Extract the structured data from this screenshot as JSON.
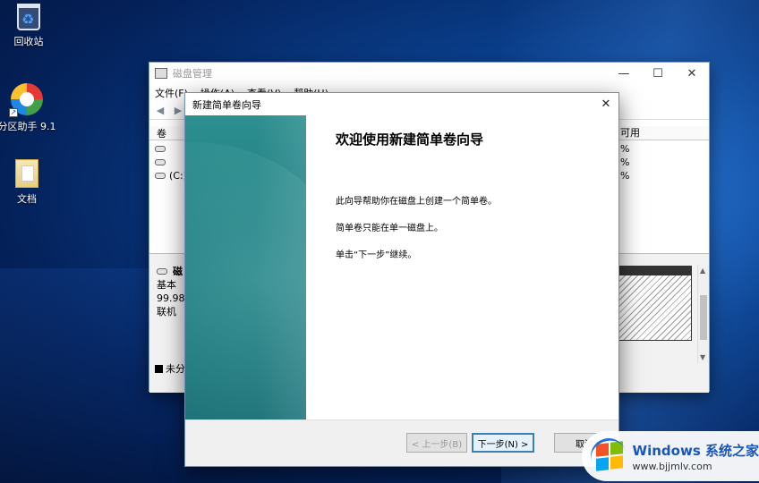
{
  "desktop": {
    "icons": [
      {
        "label": "回收站"
      },
      {
        "label": "分区助手 9.1"
      },
      {
        "label": "文档"
      }
    ]
  },
  "disk_management": {
    "title": "磁盘管理",
    "menu": [
      "文件(F)",
      "操作(A)",
      "查看(V)",
      "帮助(H)"
    ],
    "columns": {
      "volume": "卷",
      "free_pct": "可用"
    },
    "rows": [
      {
        "name": "",
        "pct": "%"
      },
      {
        "name": "",
        "pct": "%"
      },
      {
        "name": "(C:)",
        "pct": "%"
      }
    ],
    "disk": {
      "name": "磁",
      "type": "基本",
      "size": "99.98",
      "status": "联机"
    },
    "legend": "未分"
  },
  "wizard": {
    "title": "新建简单卷向导",
    "heading": "欢迎使用新建简单卷向导",
    "para1": "此向导帮助你在磁盘上创建一个简单卷。",
    "para2": "简单卷只能在单一磁盘上。",
    "para3": "单击“下一步”继续。",
    "buttons": {
      "back": "< 上一步(B)",
      "next": "下一步(N) >",
      "cancel": "取消"
    }
  },
  "watermark": {
    "brand": "Windows",
    "brand_cn": "系统之家",
    "url": "www.bjjmlv.com"
  },
  "icons": [
    "recycle-bin-icon",
    "partition-assistant-icon",
    "documents-icon",
    "disk-management-icon",
    "back-arrow-icon",
    "forward-arrow-icon",
    "disk-icon",
    "close-icon",
    "minimize-icon",
    "maximize-icon",
    "windows-logo-icon"
  ]
}
